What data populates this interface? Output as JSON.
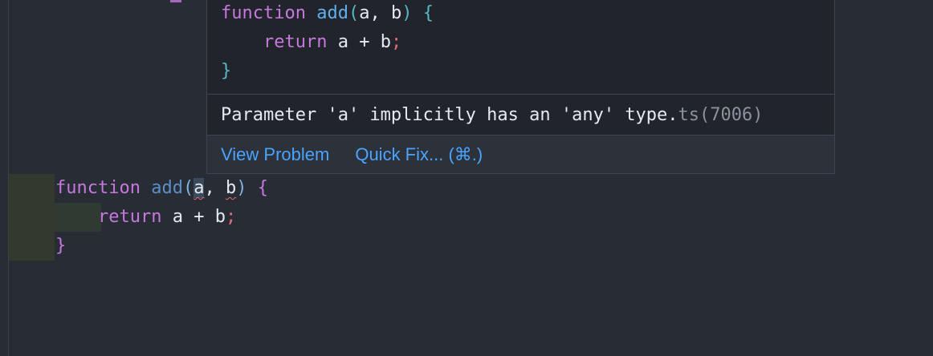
{
  "editor": {
    "lines": [
      {
        "kw": "function",
        "fn": "add",
        "open": "(",
        "p1": "a",
        "comma": ", ",
        "p2": "b",
        "close": ")",
        "brace": " {"
      },
      {
        "kw": "return",
        "expr_a": "a",
        "op": " + ",
        "expr_b": "b",
        "semi": ";"
      },
      {
        "brace": "}"
      }
    ]
  },
  "hover": {
    "code": {
      "line1": {
        "kw": "function",
        "fn": "add",
        "open": "(",
        "params": "a, b",
        "close": ")",
        "brace": " {"
      },
      "line2": {
        "kw": "return",
        "expr": "a + b",
        "semi": ";"
      },
      "line3": {
        "brace": "}"
      }
    },
    "message": "Parameter 'a' implicitly has an 'any' type.",
    "error_code": "ts(7006)",
    "actions": {
      "view_problem": "View Problem",
      "quick_fix": "Quick Fix... (⌘.)"
    }
  },
  "colors": {
    "background": "#282c34",
    "hover_background": "#21252b",
    "link": "#4aa3ff",
    "error": "#e06c75",
    "keyword": "#c678dd",
    "function": "#61afef"
  }
}
